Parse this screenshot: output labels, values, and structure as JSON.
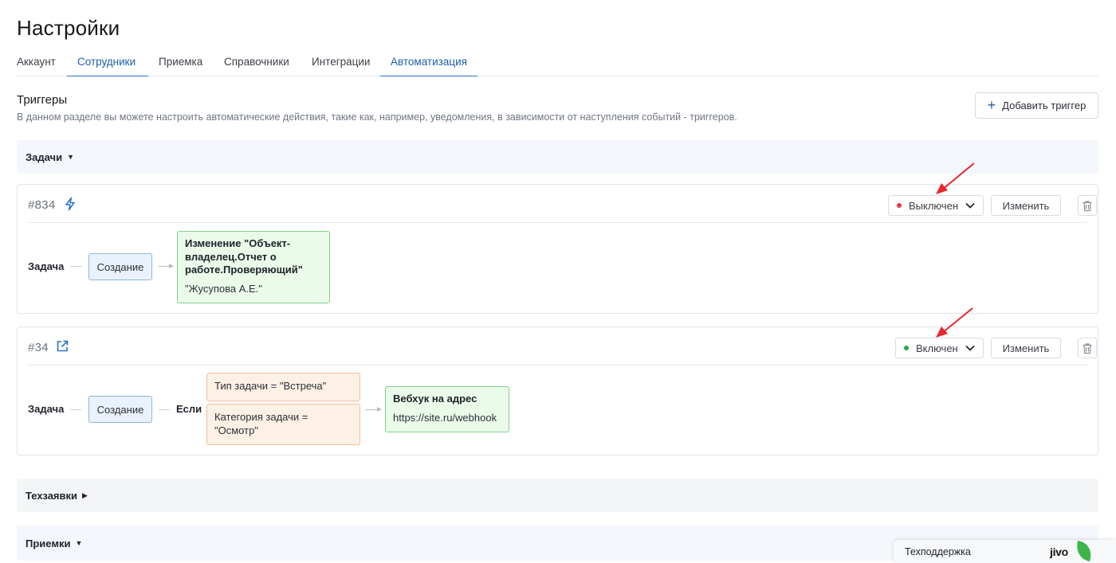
{
  "page": {
    "title": "Настройки"
  },
  "tabs": [
    {
      "label": "Аккаунт",
      "active": false
    },
    {
      "label": "Сотрудники",
      "active": true
    },
    {
      "label": "Приемка",
      "active": false
    },
    {
      "label": "Справочники",
      "active": false
    },
    {
      "label": "Интеграции",
      "active": false
    },
    {
      "label": "Автоматизация",
      "active": true
    }
  ],
  "triggers_section": {
    "title": "Триггеры",
    "description": "В данном разделе вы можете настроить автоматические действия, такие как, например, уведомления, в зависимости от наступления событий - триггеров.",
    "add_button": "Добавить триггер"
  },
  "groups": {
    "tasks": {
      "label": "Задачи",
      "expanded": true
    },
    "tech_requests": {
      "label": "Техзаявки",
      "expanded": false
    },
    "acceptances": {
      "label": "Приемки",
      "expanded": true
    }
  },
  "triggers": [
    {
      "id": "#834",
      "icon": "lightning-icon",
      "status": "Выключен",
      "status_color": "#e5393b",
      "edit_label": "Изменить",
      "entity": "Задача",
      "event": "Создание",
      "action_title": "Изменение \"Объект-владелец.Отчет о работе.Проверяющий\"",
      "action_value": "\"Жусупова А.Е.\""
    },
    {
      "id": "#34",
      "icon": "external-link-icon",
      "status": "Включен",
      "status_color": "#27a844",
      "edit_label": "Изменить",
      "entity": "Задача",
      "event": "Создание",
      "condition_label": "Если",
      "conditions": [
        "Тип задачи = \"Встреча\"",
        "Категория задачи = \"Осмотр\""
      ],
      "action_title": "Вебхук на адрес",
      "action_value": "https://site.ru/webhook"
    }
  ],
  "support_widget": {
    "label": "Техподдержка",
    "brand": "jivo"
  },
  "colors": {
    "accent": "#2a74c4",
    "annotation_arrow": "#e8262a",
    "node_blue_bg": "#e9f2fc",
    "node_green_bg": "#eafbea",
    "node_orange_bg": "#fdf0e4"
  }
}
